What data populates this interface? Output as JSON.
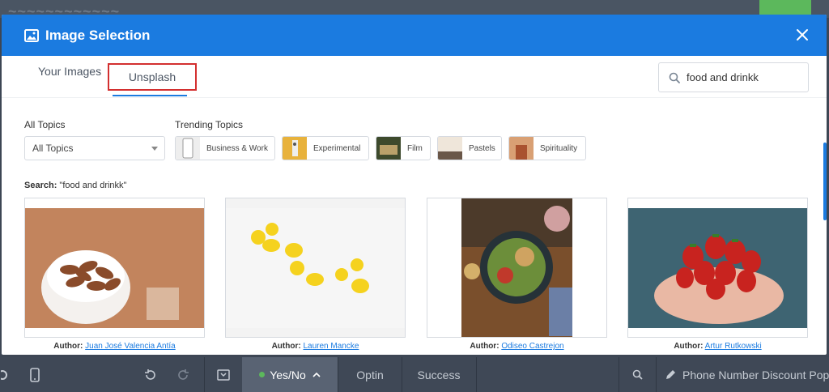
{
  "modal": {
    "title": "Image Selection",
    "tabs": [
      {
        "label": "Your Images"
      },
      {
        "label": "Unsplash"
      }
    ],
    "search": {
      "value": "food and drinkk"
    }
  },
  "filters": {
    "all_topics_label": "All Topics",
    "all_topics_selected": "All Topics",
    "trending_label": "Trending Topics",
    "trending": [
      {
        "label": "Business & Work",
        "icon": "phone-thumb"
      },
      {
        "label": "Experimental",
        "icon": "experimental-thumb"
      },
      {
        "label": "Film",
        "icon": "film-thumb"
      },
      {
        "label": "Pastels",
        "icon": "pastels-thumb"
      },
      {
        "label": "Spirituality",
        "icon": "spirituality-thumb"
      }
    ]
  },
  "results": {
    "search_prefix": "Search:",
    "search_query": "\"food and drinkk\"",
    "author_prefix": "Author:",
    "images": [
      {
        "subject": "almonds in white bowl",
        "author": "Juan José Valencia Antía"
      },
      {
        "subject": "lemons on white",
        "author": "Lauren Mancke"
      },
      {
        "subject": "salad bowl on wooden table",
        "author": "Odiseo Castrejon"
      },
      {
        "subject": "hands holding strawberries",
        "author": "Artur Rutkowski"
      }
    ]
  },
  "toolbar": {
    "status": "Yes/No",
    "optin": "Optin",
    "success": "Success",
    "campaign": "Phone Number Discount Pop"
  },
  "colors": {
    "accent": "#1b7be0",
    "highlight": "#d32f2f",
    "status_dot": "#5cb85c"
  }
}
